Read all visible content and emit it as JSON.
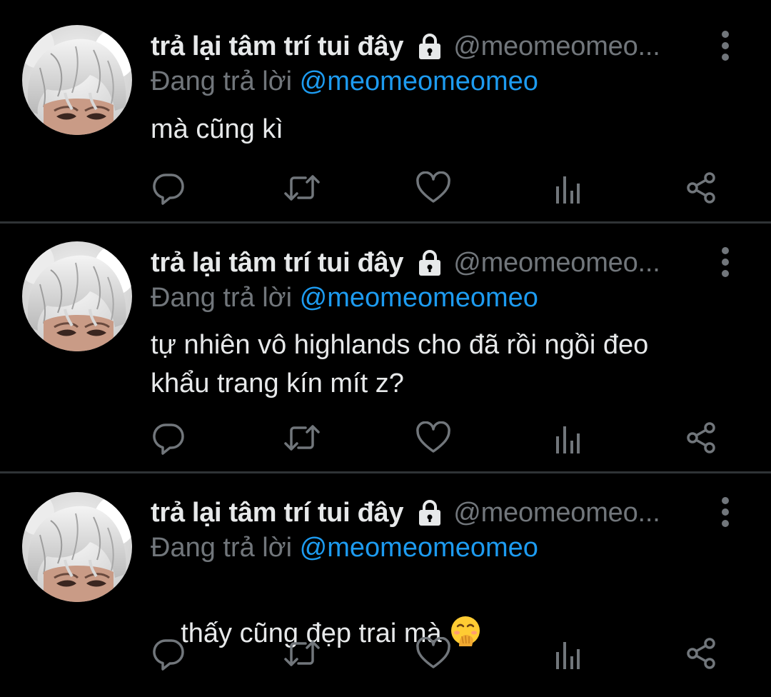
{
  "colors": {
    "background": "#000000",
    "text_primary": "#e7e9ea",
    "text_secondary": "#71767b",
    "mention": "#1d9bf0",
    "divider": "#2f3336"
  },
  "tweets": [
    {
      "display_name": "trả lại tâm trí tui đây",
      "handle": "@meomeomeo...",
      "reply_prefix": "Đang trả lời",
      "reply_mention": "@meomeomeomeo",
      "text": "mà cũng kì",
      "icons": [
        "lock-icon",
        "more-icon",
        "reply-icon",
        "retweet-icon",
        "like-icon",
        "analytics-icon",
        "share-icon"
      ]
    },
    {
      "display_name": "trả lại tâm trí tui đây",
      "handle": "@meomeomeo...",
      "reply_prefix": "Đang trả lời",
      "reply_mention": "@meomeomeomeo",
      "text": "tự nhiên vô highlands cho đã rồi ngồi đeo\nkhẩu trang kín mít z?",
      "icons": [
        "lock-icon",
        "more-icon",
        "reply-icon",
        "retweet-icon",
        "like-icon",
        "analytics-icon",
        "share-icon"
      ]
    },
    {
      "display_name": "trả lại tâm trí tui đây",
      "handle": "@meomeomeo...",
      "reply_prefix": "Đang trả lời",
      "reply_mention": "@meomeomeomeo",
      "text": "thấy cũng đẹp trai mà",
      "emoji": "face-with-hand-over-mouth-emoji",
      "icons": [
        "lock-icon",
        "more-icon",
        "reply-icon",
        "retweet-icon",
        "like-icon",
        "analytics-icon",
        "share-icon"
      ]
    }
  ]
}
